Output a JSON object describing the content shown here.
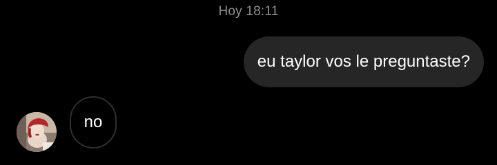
{
  "conversation": {
    "timestamp": "Hoy 18:11",
    "messages": [
      {
        "direction": "outgoing",
        "text": "eu taylor vos le preguntaste?"
      },
      {
        "direction": "incoming",
        "text": "no"
      }
    ]
  },
  "colors": {
    "background": "#000000",
    "outgoing_bubble": "#262626",
    "incoming_bubble_border": "#2f2f2f",
    "timestamp_text": "#8e8e8e",
    "message_text": "#ffffff"
  },
  "icons": {
    "contact_avatar": "avatar-photo"
  }
}
